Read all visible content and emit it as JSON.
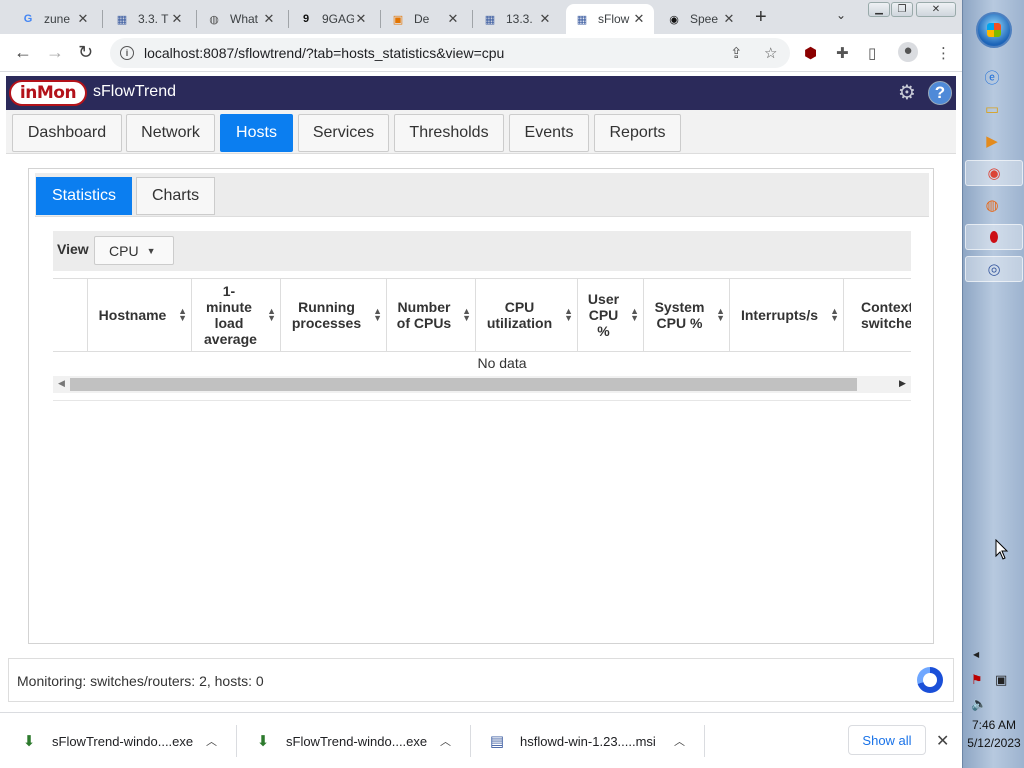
{
  "browser": {
    "tabs": [
      {
        "title": "zune",
        "icon": "google-icon",
        "glyph": "G",
        "color": "#4285f4"
      },
      {
        "title": "3.3. T",
        "icon": "chart-icon",
        "glyph": "▦",
        "color": "#3a5ba0"
      },
      {
        "title": "What",
        "icon": "globe-icon",
        "glyph": "◍",
        "color": "#555555"
      },
      {
        "title": "9GAG",
        "icon": "9gag-icon",
        "glyph": "9",
        "color": "#111111"
      },
      {
        "title": "De",
        "icon": "bookmark-icon",
        "glyph": "▣",
        "color": "#e37400"
      },
      {
        "title": "13.3.",
        "icon": "chart-icon",
        "glyph": "▦",
        "color": "#3a5ba0"
      },
      {
        "title": "sFlow",
        "icon": "chart-icon",
        "glyph": "▦",
        "color": "#3a5ba0"
      },
      {
        "title": "Spee",
        "icon": "speedtest-icon",
        "glyph": "◉",
        "color": "#111111"
      }
    ],
    "active_tab": 6,
    "url": "localhost:8087/sflowtrend/?tab=hosts_statistics&view=cpu"
  },
  "app": {
    "logo_text": "inMon",
    "title": "sFlowTrend",
    "main_tabs": [
      "Dashboard",
      "Network",
      "Hosts",
      "Services",
      "Thresholds",
      "Events",
      "Reports"
    ],
    "active_main_tab": "Hosts",
    "sub_tabs": [
      "Statistics",
      "Charts"
    ],
    "active_sub_tab": "Statistics",
    "view_label": "View",
    "view_selected": "CPU",
    "table": {
      "columns": [
        "",
        "Hostname",
        "1-minute load average",
        "Running processes",
        "Number of CPUs",
        "CPU utilization",
        "User CPU %",
        "System CPU %",
        "Interrupts/s",
        "Context switches"
      ],
      "empty_text": "No data"
    },
    "status_text": "Monitoring: switches/routers: 2, hosts: 0"
  },
  "downloads": {
    "items": [
      "sFlowTrend-windo....exe",
      "sFlowTrend-windo....exe",
      "hsflowd-win-1.23.....msi"
    ],
    "show_all": "Show all"
  },
  "taskbar": {
    "time": "7:46 AM",
    "date": "5/12/2023"
  }
}
